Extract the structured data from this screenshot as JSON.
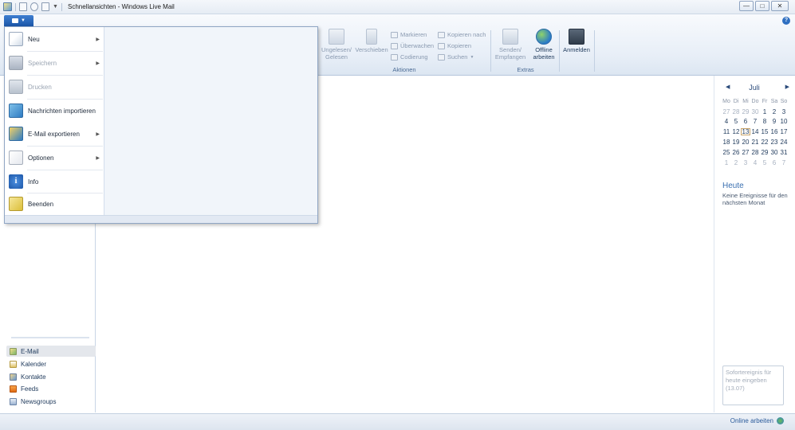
{
  "window": {
    "title": "Schnellansichten - Windows Live Mail",
    "buttons": {
      "minimize": "—",
      "maximize": "□",
      "close": "✕"
    }
  },
  "ribbon": {
    "groups": [
      {
        "name": "Aktionen",
        "big_buttons": [
          {
            "label_line1": "Ungelesen/",
            "label_line2": "Gelesen",
            "icon": "envelope-icon"
          },
          {
            "label_line1": "Verschieben",
            "label_line2": "",
            "icon": "move-icon"
          }
        ],
        "small_buttons": [
          {
            "label": "Markieren",
            "icon": "flag-icon"
          },
          {
            "label": "Überwachen",
            "icon": "watch-icon"
          },
          {
            "label": "Codierung",
            "icon": "encoding-icon"
          },
          {
            "label": "Kopieren nach",
            "icon": "copy-to-icon"
          },
          {
            "label": "Kopieren",
            "icon": "copy-icon"
          },
          {
            "label": "Suchen",
            "icon": "binoculars-icon"
          }
        ]
      },
      {
        "name": "Extras",
        "big_buttons": [
          {
            "label_line1": "Senden/",
            "label_line2": "Empfangen",
            "icon": "send-receive-icon"
          },
          {
            "label_line1": "Offline",
            "label_line2": "arbeiten",
            "icon": "globe-icon"
          }
        ]
      },
      {
        "name": "",
        "big_buttons": [
          {
            "label_line1": "Anmelden",
            "label_line2": "",
            "icon": "sign-in-icon"
          }
        ]
      }
    ]
  },
  "app_menu": {
    "items": [
      {
        "label": "Neu",
        "icon": "new-icon",
        "submenu": true,
        "enabled": true
      },
      {
        "label": "Speichern",
        "icon": "save-icon",
        "submenu": true,
        "enabled": false
      },
      {
        "label": "Drucken",
        "icon": "print-icon",
        "submenu": false,
        "enabled": false
      },
      {
        "label": "Nachrichten importieren",
        "icon": "import-icon",
        "submenu": false,
        "enabled": true
      },
      {
        "label": "E-Mail exportieren",
        "icon": "export-icon",
        "submenu": true,
        "enabled": true
      },
      {
        "label": "Optionen",
        "icon": "options-icon",
        "submenu": true,
        "enabled": true
      },
      {
        "label": "Info",
        "icon": "info-icon",
        "submenu": false,
        "enabled": true
      },
      {
        "label": "Beenden",
        "icon": "exit-icon",
        "submenu": false,
        "enabled": true
      }
    ]
  },
  "nav": {
    "items": [
      {
        "label": "E-Mail",
        "icon": "mail-icon",
        "selected": true
      },
      {
        "label": "Kalender",
        "icon": "calendar-icon",
        "selected": false
      },
      {
        "label": "Kontakte",
        "icon": "contacts-icon",
        "selected": false
      },
      {
        "label": "Feeds",
        "icon": "feeds-icon",
        "selected": false
      },
      {
        "label": "Newsgroups",
        "icon": "newsgroups-icon",
        "selected": false
      }
    ]
  },
  "calendar": {
    "month": "Juli",
    "prev": "◀",
    "next": "▶",
    "weekdays": [
      "Mo",
      "Di",
      "Mi",
      "Do",
      "Fr",
      "Sa",
      "So"
    ],
    "weeks": [
      [
        "27",
        "28",
        "29",
        "30",
        "1",
        "2",
        "3"
      ],
      [
        "4",
        "5",
        "6",
        "7",
        "8",
        "9",
        "10"
      ],
      [
        "11",
        "12",
        "13",
        "14",
        "15",
        "16",
        "17"
      ],
      [
        "18",
        "19",
        "20",
        "21",
        "22",
        "23",
        "24"
      ],
      [
        "25",
        "26",
        "27",
        "28",
        "29",
        "30",
        "31"
      ],
      [
        "1",
        "2",
        "3",
        "4",
        "5",
        "6",
        "7"
      ]
    ],
    "today": "13",
    "today_heading": "Heute",
    "today_text": "Keine Ereignisse für den nächsten Monat",
    "quick_event_placeholder": "Sofortereignis für heute eingeben (13.07)"
  },
  "status": {
    "online_label": "Online arbeiten"
  },
  "colors": {
    "accent": "#1b56a8",
    "ribbon_bg": "#e7eef7",
    "today_outline": "#c8a46a"
  }
}
